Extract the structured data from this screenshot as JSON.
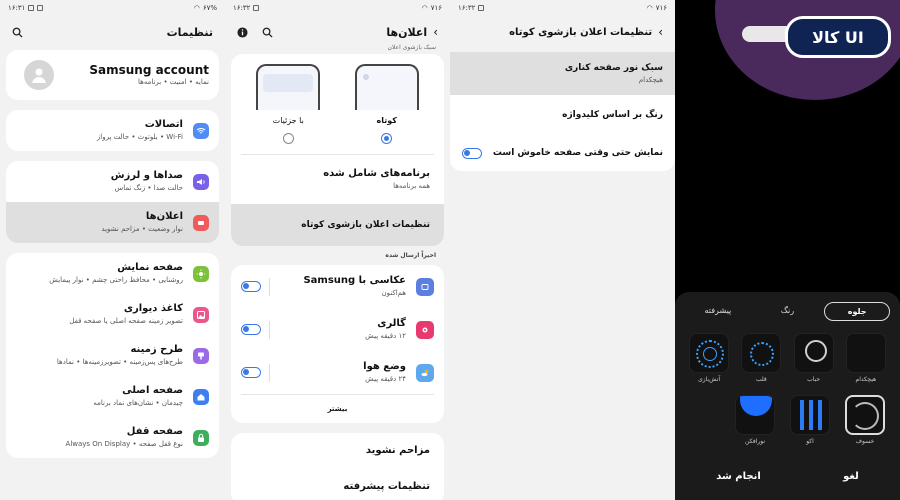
{
  "panel1": {
    "status": {
      "time": "۱۶:۳۱",
      "battery": "۶۷%"
    },
    "title": "تنظیمات",
    "account": {
      "name": "Samsung account",
      "sub": "نمایه • امنیت • برنامه‌ها"
    },
    "items": [
      {
        "label": "اتصالات",
        "sub": "Wi-Fi • بلوتوث • حالت پرواز",
        "color": "#4f8df5"
      },
      {
        "label": "صداها و لرزش",
        "sub": "حالت صدا • زنگ تماس",
        "color": "#7b61e8"
      },
      {
        "label": "اعلان‌ها",
        "sub": "نوار وضعیت • مزاحم نشوید",
        "color": "#ef5a5a"
      },
      {
        "label": "صفحه نمایش",
        "sub": "روشنایی • محافظ راحتی چشم • نوار پیمایش",
        "color": "#7bc23a"
      },
      {
        "label": "کاغذ دیواری",
        "sub": "تصویر زمینه صفحه اصلی یا صفحه قفل",
        "color": "#e9578c"
      },
      {
        "label": "طرح زمینه",
        "sub": "طرح‌های پس‌زمینه • تصویرزمینه‌ها • نمادها",
        "color": "#9a6ae8"
      },
      {
        "label": "صفحه اصلی",
        "sub": "چیدمان • نشان‌های نماد برنامه",
        "color": "#3d7ff0"
      },
      {
        "label": "صفحه قفل",
        "sub": "نوع قفل صفحه • Always On Display",
        "color": "#3cae5c"
      }
    ]
  },
  "panel2": {
    "status": {
      "time": "۱۶:۳۲",
      "battery": "۷۱۶"
    },
    "title": "اعلان‌ها",
    "popup_style_label": "سبک بازشوی اعلان",
    "styles": [
      {
        "label": "کوتاه",
        "selected": true
      },
      {
        "label": "با جزئیات",
        "selected": false
      }
    ],
    "included_apps": {
      "label": "برنامه‌های شامل شده",
      "sub": "همه برنامه‌ها"
    },
    "brief_settings": "تنظیمات اعلان بازشوی کوتاه",
    "recent_label": "اخیراً ارسال شده",
    "recent": [
      {
        "label": "عکاسی با Samsung",
        "sub": "هم‌اکنون",
        "color": "#5a7fe0"
      },
      {
        "label": "گالری",
        "sub": "۱۲ دقیقه پیش",
        "color": "#e83a6e"
      },
      {
        "label": "وضع هوا",
        "sub": "۲۴ دقیقه پیش",
        "color": "#f5b400"
      }
    ],
    "more": "بیشتر",
    "dnd": "مزاحم نشوید",
    "advanced": "تنظیمات پیشرفته"
  },
  "panel3": {
    "status": {
      "time": "۱۶:۳۲",
      "battery": "۷۱۶"
    },
    "title": "تنظیمات اعلان بازشوی کوتاه",
    "edge_style": {
      "label": "سبک نور صفحه کناری",
      "sub": "هیچکدام"
    },
    "keyword_color": "رنگ بر اساس کلیدواژه",
    "show_when_off": "نمایش حتی وقتی صفحه خاموش است"
  },
  "panel4": {
    "logo": "UI کالا",
    "tabs": [
      "جلوه",
      "رنگ",
      "پیشرفته"
    ],
    "effects_row1": [
      "هیچکدام",
      "حباب",
      "قلب",
      "آتش‌بازی"
    ],
    "effects_row2": [
      "خسوف",
      "اکو",
      "نورافکن"
    ],
    "cancel": "لغو",
    "done": "انجام شد",
    "accent": "#1e6fff"
  }
}
